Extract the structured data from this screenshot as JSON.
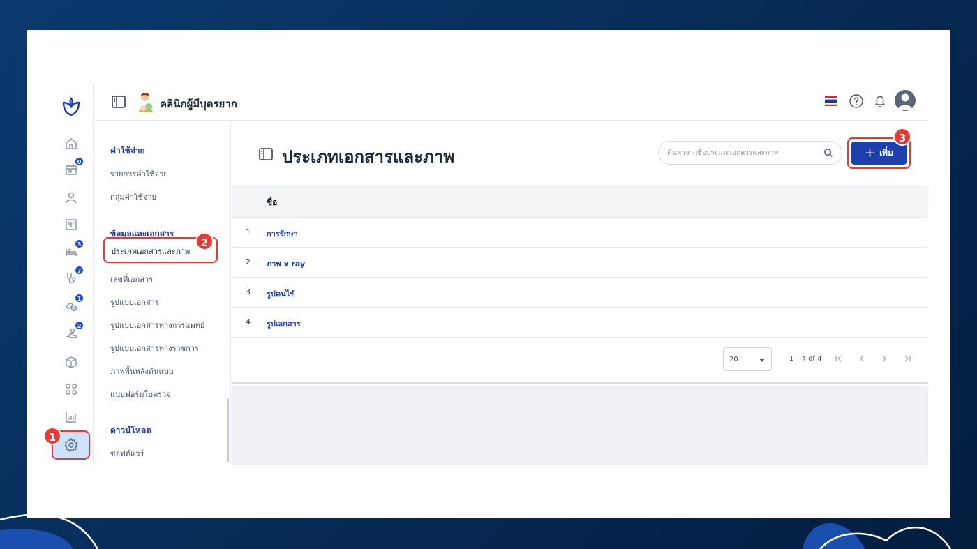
{
  "app": {
    "clinic_name": "คลินิกผู้มีบุตรยาก"
  },
  "rail": {
    "badges": {
      "calendar": "0",
      "bed": "3",
      "stethoscope": "7",
      "pills": "1",
      "hand": "2"
    }
  },
  "subnav": {
    "sections": [
      {
        "title": "ค่าใช้จ่าย",
        "items": [
          "รายการค่าใช้จ่าย",
          "กลุ่มค่าใช้จ่าย"
        ]
      },
      {
        "title": "ข้อมูลและเอกสาร",
        "items": [
          "ประเภทเอกสารและภาพ",
          "เลขที่เอกสาร",
          "รูปแบบเอกสาร",
          "รูปแบบเอกสารทางการแพทย์",
          "รูปแบบเอกสารทางราชการ",
          "ภาพพื้นหลังต้นแบบ",
          "แบบฟอร์มใบตรวจ"
        ]
      },
      {
        "title": "ดาวน์โหลด",
        "items": [
          "ซอฟต์แวร์"
        ]
      }
    ]
  },
  "main": {
    "title": "ประเภทเอกสารและภาพ",
    "search_placeholder": "ค้นหาจากชื่อประเภทเอกสารและภาพ",
    "add_label": "เพิ่ม",
    "column_name": "ชื่อ",
    "rows": [
      {
        "num": "1",
        "name": "การรักษา"
      },
      {
        "num": "2",
        "name": "ภาพ x ray"
      },
      {
        "num": "3",
        "name": "รูปคนไข้"
      },
      {
        "num": "4",
        "name": "รูปเอกสาร"
      }
    ],
    "page_size": "20",
    "range": "1 – 4 of 4"
  },
  "markers": [
    "1",
    "2",
    "3"
  ],
  "colors": {
    "accent": "#1e40af",
    "highlight": "#e53935",
    "background": "#062a55"
  }
}
